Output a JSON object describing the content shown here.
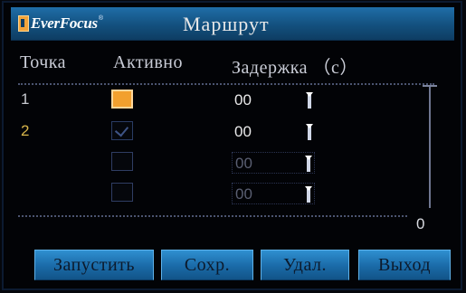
{
  "window": {
    "title": "Маршрут"
  },
  "logo": {
    "text": "EverFocus",
    "reg": "®"
  },
  "columns": {
    "point": "Точка",
    "active": "Активно",
    "delay": "Задержка  （с）"
  },
  "rows": [
    {
      "number": "1",
      "active_state": "selected",
      "delay": "00"
    },
    {
      "number": "2",
      "active_state": "checked",
      "delay": "00"
    },
    {
      "number": "",
      "active_state": "empty",
      "delay": "00"
    },
    {
      "number": "",
      "active_state": "empty",
      "delay": "00"
    }
  ],
  "scroll": {
    "value": "0"
  },
  "buttons": {
    "start": "Запустить",
    "save": "Сохр.",
    "delete": "Удал.",
    "exit": "Выход"
  },
  "colors": {
    "accent": "#1a6aa7",
    "selected": "#f2a02e",
    "row2_number": "#d8b54a"
  }
}
